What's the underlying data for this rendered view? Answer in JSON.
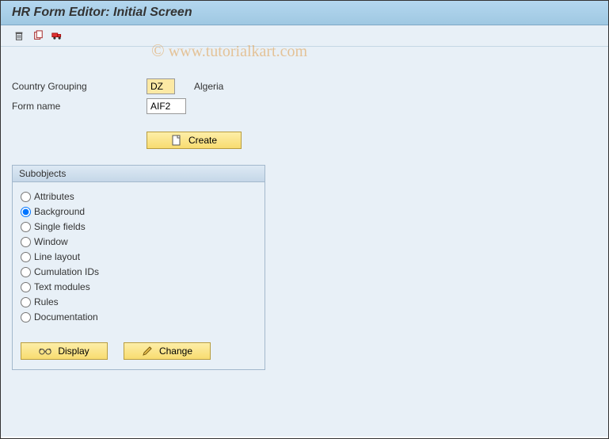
{
  "header": {
    "title": "HR Form Editor: Initial Screen"
  },
  "toolbar": {
    "delete_icon": "Delete",
    "copy_icon": "Copy",
    "transport_icon": "Transport"
  },
  "fields": {
    "country_grouping": {
      "label": "Country Grouping",
      "value": "DZ",
      "description": "Algeria"
    },
    "form_name": {
      "label": "Form name",
      "value": "AIF2"
    }
  },
  "buttons": {
    "create": "Create",
    "display": "Display",
    "change": "Change"
  },
  "subobjects": {
    "header": "Subobjects",
    "items": [
      {
        "id": "attributes",
        "label": "Attributes",
        "selected": false
      },
      {
        "id": "background",
        "label": "Background",
        "selected": true
      },
      {
        "id": "single_fields",
        "label": "Single fields",
        "selected": false
      },
      {
        "id": "window",
        "label": "Window",
        "selected": false
      },
      {
        "id": "line_layout",
        "label": "Line layout",
        "selected": false
      },
      {
        "id": "cumulation_ids",
        "label": "Cumulation IDs",
        "selected": false
      },
      {
        "id": "text_modules",
        "label": "Text modules",
        "selected": false
      },
      {
        "id": "rules",
        "label": "Rules",
        "selected": false
      },
      {
        "id": "documentation",
        "label": "Documentation",
        "selected": false
      }
    ]
  },
  "watermark": "© www.tutorialkart.com"
}
